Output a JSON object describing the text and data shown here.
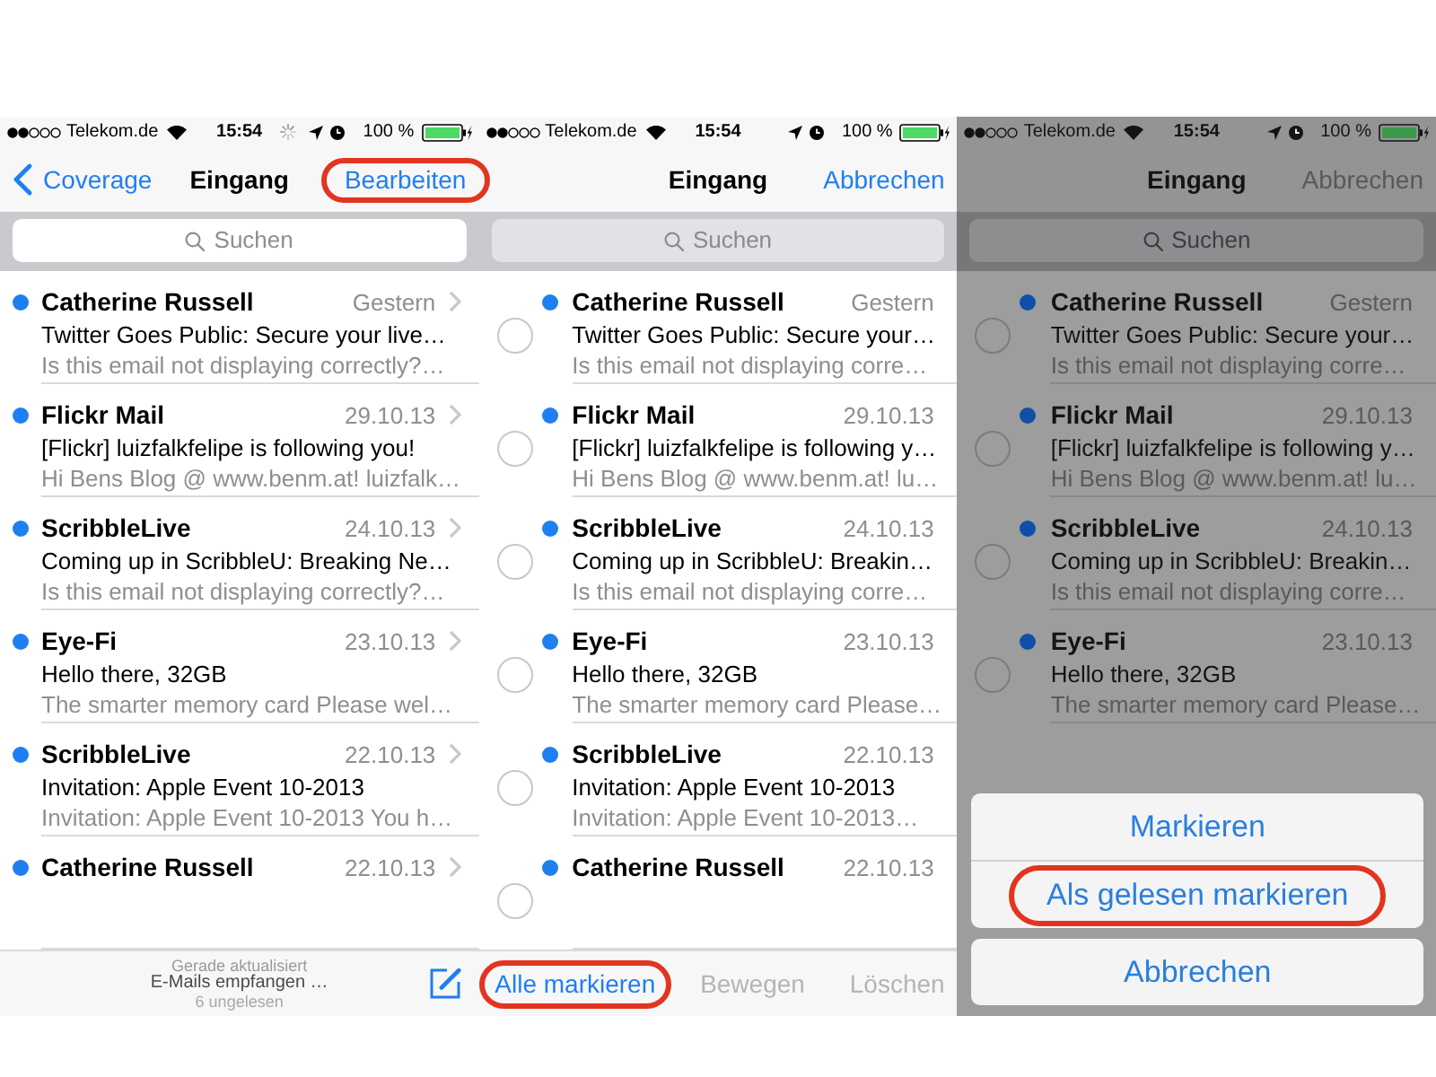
{
  "panels": [
    {
      "dimmed": false,
      "edit_mode": false,
      "status_bar": {
        "carrier": "Telekom.de",
        "time": "15:54",
        "busy": true,
        "battery": "100 %"
      },
      "nav": {
        "back": "Coverage",
        "title": "Eingang",
        "action": {
          "label": "Bearbeiten",
          "highlighted": true
        }
      },
      "search": {
        "placeholder": "Suchen",
        "disabled": false
      },
      "messages": [
        {
          "sender": "Catherine Russell",
          "date": "Gestern",
          "subject": "Twitter Goes Public: Secure your live…",
          "preview": "Is this email not displaying correctly?…",
          "unread": true
        },
        {
          "sender": "Flickr Mail",
          "date": "29.10.13",
          "subject": "[Flickr] luizfalkfelipe is following you!",
          "preview": "Hi Bens Blog @ www.benm.at! luizfalk…",
          "unread": true
        },
        {
          "sender": "ScribbleLive",
          "date": "24.10.13",
          "subject": "Coming up in ScribbleU: Breaking Ne…",
          "preview": "Is this email not displaying correctly?…",
          "unread": true
        },
        {
          "sender": "Eye-Fi",
          "date": "23.10.13",
          "subject": "Hello there, 32GB",
          "preview": "The smarter memory card Please wel…",
          "unread": true
        },
        {
          "sender": "ScribbleLive",
          "date": "22.10.13",
          "subject": "Invitation: Apple Event 10-2013",
          "preview": "Invitation: Apple Event 10-2013 You h…",
          "unread": true
        },
        {
          "sender": "Catherine Russell",
          "date": "22.10.13",
          "unread": true
        }
      ],
      "toolbar": {
        "kind": "status",
        "lines": [
          "Gerade aktualisiert",
          "E-Mails empfangen …",
          "6 ungelesen"
        ]
      }
    },
    {
      "dimmed": false,
      "edit_mode": true,
      "status_bar": {
        "carrier": "Telekom.de",
        "time": "15:54",
        "busy": false,
        "battery": "100 %"
      },
      "nav": {
        "title": "Eingang",
        "action": {
          "label": "Abbrechen",
          "highlighted": false
        }
      },
      "search": {
        "placeholder": "Suchen",
        "disabled": true
      },
      "messages": [
        {
          "sender": "Catherine Russell",
          "date": "Gestern",
          "subject": "Twitter Goes Public: Secure your…",
          "preview": "Is this email not displaying corre…",
          "unread": true,
          "selected": false
        },
        {
          "sender": "Flickr Mail",
          "date": "29.10.13",
          "subject": "[Flickr] luizfalkfelipe is following y…",
          "preview": "Hi Bens Blog @ www.benm.at! lu…",
          "unread": true,
          "selected": false
        },
        {
          "sender": "ScribbleLive",
          "date": "24.10.13",
          "subject": "Coming up in ScribbleU: Breakin…",
          "preview": "Is this email not displaying corre…",
          "unread": true,
          "selected": false
        },
        {
          "sender": "Eye-Fi",
          "date": "23.10.13",
          "subject": "Hello there, 32GB",
          "preview": "The smarter memory card Please…",
          "unread": true,
          "selected": false
        },
        {
          "sender": "ScribbleLive",
          "date": "22.10.13",
          "subject": "Invitation: Apple Event 10-2013",
          "preview": "Invitation: Apple Event 10-2013…",
          "unread": true,
          "selected": false
        },
        {
          "sender": "Catherine Russell",
          "date": "22.10.13",
          "unread": true,
          "selected": false
        }
      ],
      "toolbar": {
        "kind": "actions",
        "buttons": [
          {
            "label": "Alle markieren",
            "disabled": false,
            "highlighted": true
          },
          {
            "label": "Bewegen",
            "disabled": true,
            "highlighted": false
          },
          {
            "label": "Löschen",
            "disabled": true,
            "highlighted": false
          }
        ]
      }
    },
    {
      "dimmed": true,
      "edit_mode": true,
      "status_bar": {
        "carrier": "Telekom.de",
        "time": "15:54",
        "busy": false,
        "battery": "100 %"
      },
      "nav": {
        "title": "Eingang",
        "action": {
          "label": "Abbrechen",
          "highlighted": false
        }
      },
      "search": {
        "placeholder": "Suchen",
        "disabled": true
      },
      "messages": [
        {
          "sender": "Catherine Russell",
          "date": "Gestern",
          "subject": "Twitter Goes Public: Secure your…",
          "preview": "Is this email not displaying corre…",
          "unread": true,
          "selected": false
        },
        {
          "sender": "Flickr Mail",
          "date": "29.10.13",
          "subject": "[Flickr] luizfalkfelipe is following y…",
          "preview": "Hi Bens Blog @ www.benm.at! lu…",
          "unread": true,
          "selected": false
        },
        {
          "sender": "ScribbleLive",
          "date": "24.10.13",
          "subject": "Coming up in ScribbleU: Breakin…",
          "preview": "Is this email not displaying corre…",
          "unread": true,
          "selected": false
        },
        {
          "sender": "Eye-Fi",
          "date": "23.10.13",
          "subject": "Hello there, 32GB",
          "preview": "The smarter memory card Please…",
          "unread": true,
          "selected": false
        }
      ],
      "action_sheet": {
        "groups": [
          [
            {
              "label": "Markieren",
              "highlighted": false
            },
            {
              "label": "Als gelesen markieren",
              "highlighted": true
            }
          ],
          [
            {
              "label": "Abbrechen",
              "highlighted": false
            }
          ]
        ]
      }
    }
  ]
}
